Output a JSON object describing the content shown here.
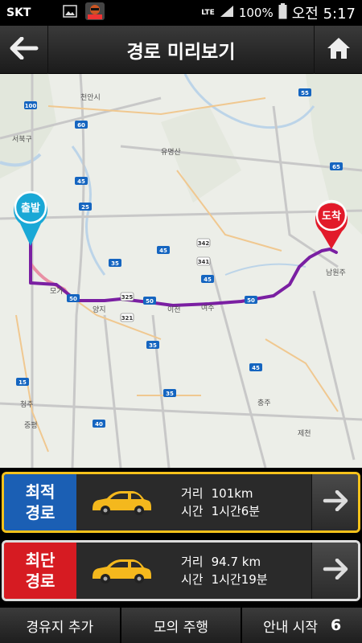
{
  "status_bar": {
    "carrier": "SKT",
    "network": "LTE",
    "battery": "100%",
    "time": "오전 5:17"
  },
  "header": {
    "title": "경로 미리보기",
    "back_icon": "arrow-left-icon",
    "home_icon": "home-icon"
  },
  "map": {
    "start_label": "출발",
    "end_label": "도착",
    "places": [
      "천안시",
      "서북구",
      "유명산",
      "모가",
      "이천",
      "여주",
      "양지",
      "충주",
      "남원주",
      "청주",
      "중평",
      "제천"
    ],
    "road_numbers": [
      "100",
      "45",
      "25",
      "35",
      "15",
      "50",
      "40",
      "55",
      "65",
      "60",
      "341",
      "325",
      "321",
      "342"
    ],
    "colors": {
      "start_pin": "#1aa8d6",
      "end_pin": "#e21a2a",
      "route_fast": "#7a1fa2",
      "route_short": "#e890a4"
    }
  },
  "routes": [
    {
      "tag_line1": "최적",
      "tag_line2": "경로",
      "tag_color": "#1b5fb4",
      "distance_label": "거리",
      "distance_value": "101km",
      "time_label": "시간",
      "time_value": "1시간6분",
      "selected": true
    },
    {
      "tag_line1": "최단",
      "tag_line2": "경로",
      "tag_color": "#d61b22",
      "distance_label": "거리",
      "distance_value": "94.7 km",
      "time_label": "시간",
      "time_value": "1시간19분",
      "selected": false
    }
  ],
  "bottom_bar": {
    "add_waypoint": "경유지 추가",
    "simulate": "모의 주행",
    "start_guidance": "안내 시작",
    "countdown": "6"
  }
}
